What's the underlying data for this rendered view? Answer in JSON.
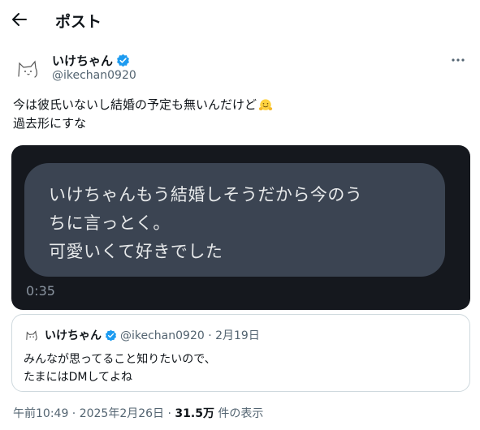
{
  "header": {
    "back_icon": "arrow-left-icon",
    "title": "ポスト"
  },
  "author": {
    "name": "いけちゃん",
    "handle": "@ikechan0920",
    "verified_color": "#1d9bf0",
    "more_icon": "more-dots-icon"
  },
  "post": {
    "line1": "今は彼氏いないし結婚の予定も無いんだけど",
    "line1_emoji": "hugging-face-emoji",
    "line2": "過去形にすな"
  },
  "media": {
    "bubble_line1": "いけちゃんもう結婚しそうだから今のう",
    "bubble_line2": "ちに言っとく。",
    "bubble_line3": "可愛いくて好きでした",
    "duration": "0:35"
  },
  "quote": {
    "name": "いけちゃん",
    "meta": "@ikechan0920 · 2月19日",
    "line1": "みんなが思ってること知りたいので、",
    "line2": "たまにはDMしてよね"
  },
  "footer": {
    "timestamp": "午前10:49 · 2025年2月26日 · ",
    "views_count": "31.5万",
    "views_label": " 件の表示"
  }
}
